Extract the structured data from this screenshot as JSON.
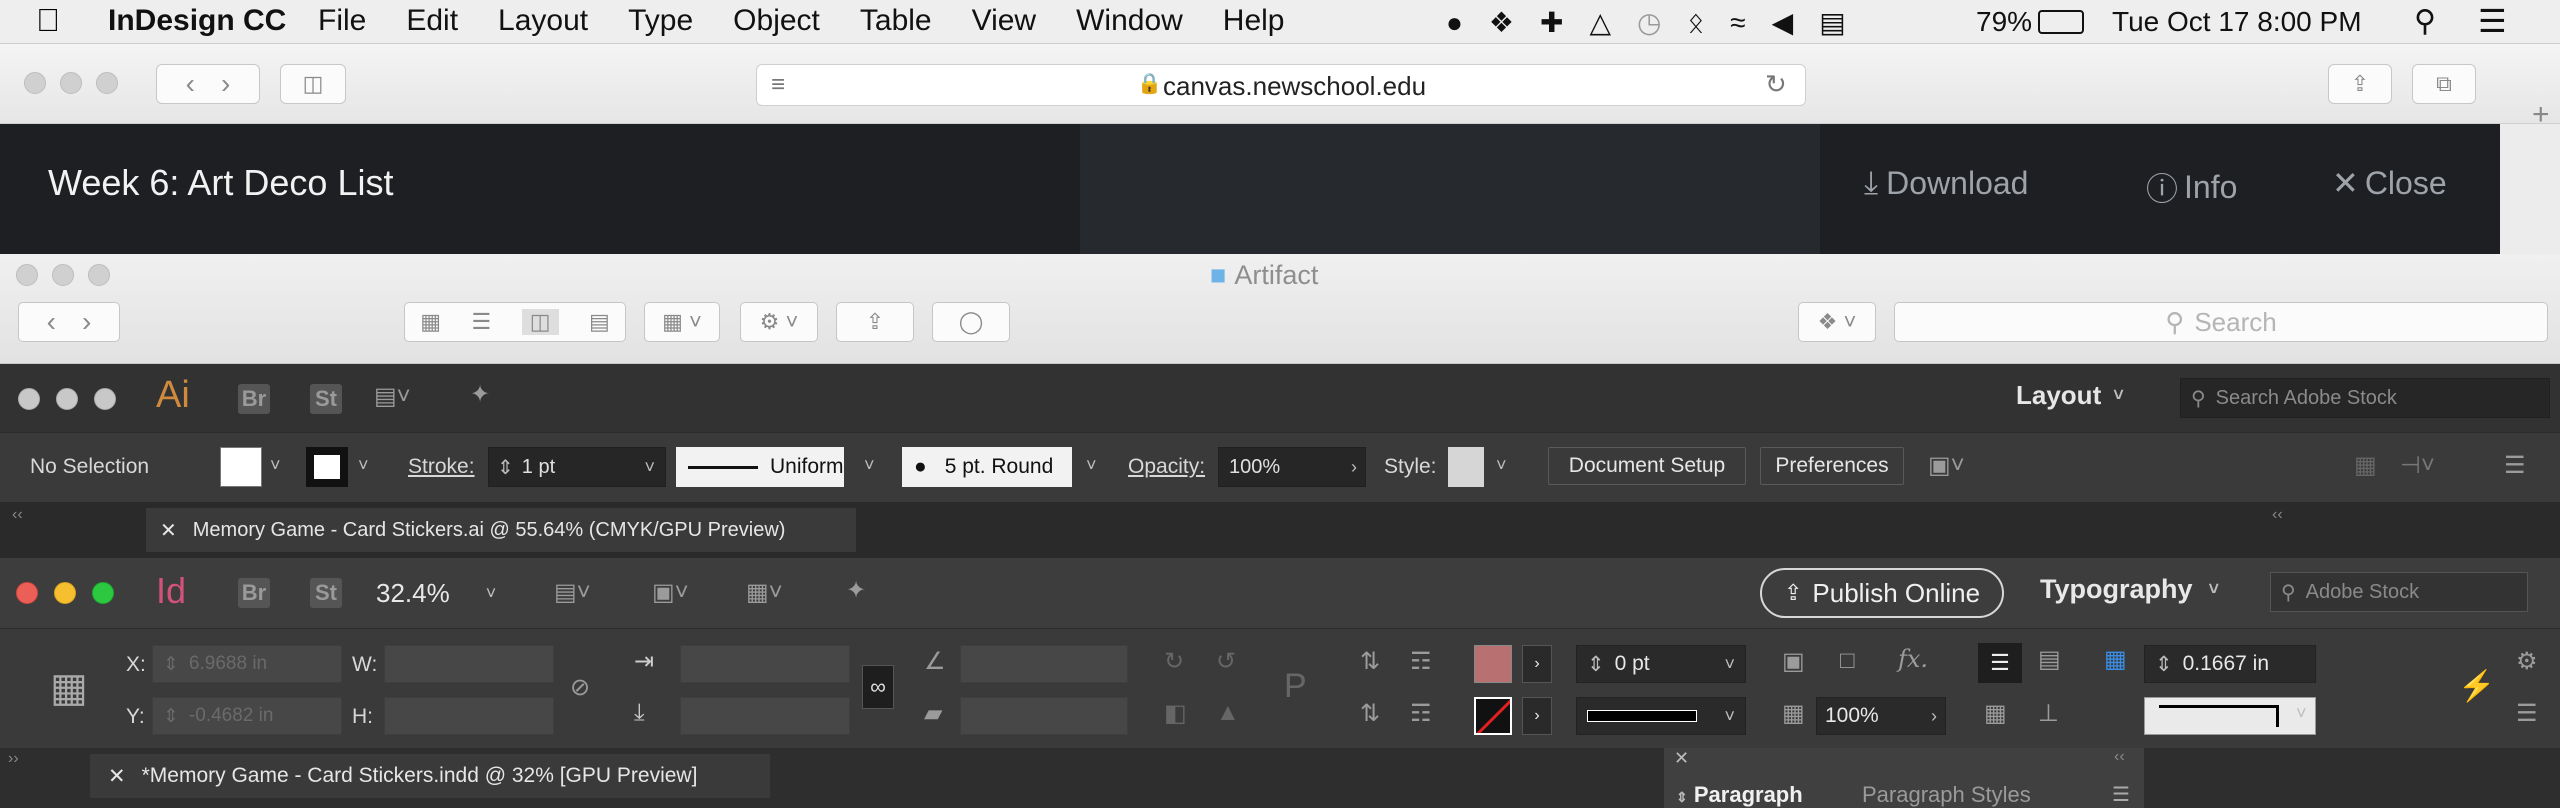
{
  "menubar": {
    "apple": "",
    "app_name": "InDesign CC",
    "items": [
      "File",
      "Edit",
      "Layout",
      "Type",
      "Object",
      "Table",
      "View",
      "Window",
      "Help"
    ],
    "battery": "79%",
    "datetime": "Tue Oct 17  8:00 PM"
  },
  "browser": {
    "url": "canvas.newschool.edu",
    "preview_title": "Week 6: Art Deco List",
    "download_label": "Download",
    "info_label": "Info",
    "close_label": "Close"
  },
  "finder": {
    "title": "Artifact",
    "search_placeholder": "Search"
  },
  "illustrator": {
    "app_icon": "Ai",
    "bridge_icon": "Br",
    "stock_icon": "St",
    "workspace": "Layout",
    "stock_search_placeholder": "Search Adobe Stock",
    "selection": "No Selection",
    "stroke_label": "Stroke:",
    "stroke_value": "1 pt",
    "stroke_profile": "Uniform",
    "brush": "5 pt. Round",
    "opacity_label": "Opacity:",
    "opacity_value": "100%",
    "style_label": "Style:",
    "document_setup_label": "Document Setup",
    "preferences_label": "Preferences",
    "tab_title": "Memory Game - Card Stickers.ai @ 55.64% (CMYK/GPU Preview)"
  },
  "indesign": {
    "app_icon": "Id",
    "bridge_icon": "Br",
    "stock_icon": "St",
    "zoom": "32.4%",
    "publish_label": "Publish Online",
    "workspace": "Typography",
    "stock_search_placeholder": "Adobe Stock",
    "x_label": "X:",
    "x_value": "6.9688 in",
    "y_label": "Y:",
    "y_value": "-0.4682 in",
    "w_label": "W:",
    "h_label": "H:",
    "stroke_weight": "0 pt",
    "opacity": "100%",
    "gutter": "0.1667 in",
    "tab_title": "*Memory Game - Card Stickers.indd @ 32% [GPU Preview]",
    "panel_paragraph": "Paragraph",
    "panel_paragraph_styles": "Paragraph Styles",
    "fill_color": "#b87070"
  }
}
